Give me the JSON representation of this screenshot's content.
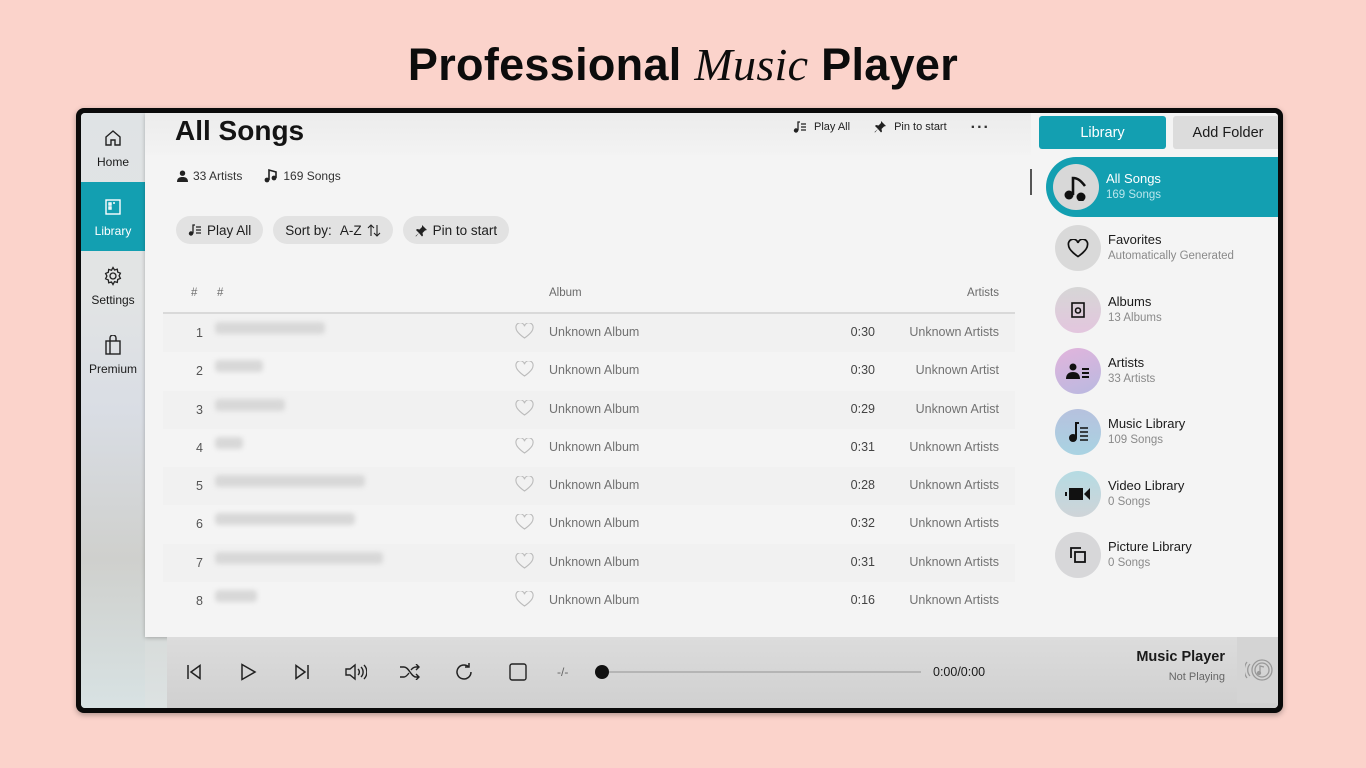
{
  "headline": {
    "part1": "Professional",
    "part2": "Music",
    "part3": "Player"
  },
  "nav": {
    "items": [
      {
        "label": "Home",
        "icon": "home-icon",
        "active": false
      },
      {
        "label": "Library",
        "icon": "library-icon",
        "active": true
      },
      {
        "label": "Settings",
        "icon": "gear-icon",
        "active": false
      },
      {
        "label": "Premium",
        "icon": "shopping-bag-icon",
        "active": false
      }
    ]
  },
  "main": {
    "title": "All Songs",
    "top_actions": {
      "play_all": "Play All",
      "pin_to_start": "Pin to start",
      "more": "..."
    },
    "stats": {
      "artists": "33 Artists",
      "songs": "169 Songs"
    },
    "pills": {
      "play_all": "Play All",
      "sort_label": "Sort by:",
      "sort_value": "A-Z",
      "pin_to_start": "Pin to start"
    },
    "table": {
      "headers": {
        "num": "#",
        "title": "#",
        "album": "Album",
        "artists": "Artists"
      },
      "rows": [
        {
          "num": "1",
          "title": "[blurred]",
          "album": "Unknown Album",
          "duration": "0:30",
          "artist": "Unknown Artists"
        },
        {
          "num": "2",
          "title": "[blurred]",
          "album": "Unknown Album",
          "duration": "0:30",
          "artist": "Unknown Artist"
        },
        {
          "num": "3",
          "title": "[blurred]",
          "album": "Unknown Album",
          "duration": "0:29",
          "artist": "Unknown Artist"
        },
        {
          "num": "4",
          "title": "[blurred]",
          "album": "Unknown Album",
          "duration": "0:31",
          "artist": "Unknown Artists"
        },
        {
          "num": "5",
          "title": "[blurred]",
          "album": "Unknown Album",
          "duration": "0:28",
          "artist": "Unknown Artists"
        },
        {
          "num": "6",
          "title": "[blurred]",
          "album": "Unknown Album",
          "duration": "0:32",
          "artist": "Unknown Artists"
        },
        {
          "num": "7",
          "title": "[blurred]",
          "album": "Unknown Album",
          "duration": "0:31",
          "artist": "Unknown Artists"
        },
        {
          "num": "8",
          "title": "[blurred]",
          "album": "Unknown Album",
          "duration": "0:16",
          "artist": "Unknown Artists"
        }
      ]
    }
  },
  "right_panel": {
    "tabs": {
      "library": "Library",
      "add_folder": "Add Folder"
    },
    "categories": [
      {
        "label": "All Songs",
        "sub": "169 Songs",
        "icon": "music-notes-icon",
        "active": true
      },
      {
        "label": "Favorites",
        "sub": "Automatically Generated",
        "icon": "heart-icon",
        "active": false
      },
      {
        "label": "Albums",
        "sub": "13 Albums",
        "icon": "album-icon",
        "active": false
      },
      {
        "label": "Artists",
        "sub": "33 Artists",
        "icon": "artist-list-icon",
        "active": false
      },
      {
        "label": "Music Library",
        "sub": "109 Songs",
        "icon": "music-list-icon",
        "active": false
      },
      {
        "label": "Video Library",
        "sub": "0 Songs",
        "icon": "video-camera-icon",
        "active": false
      },
      {
        "label": "Picture Library",
        "sub": "0 Songs",
        "icon": "pictures-icon",
        "active": false
      }
    ]
  },
  "player": {
    "rate": "-/-",
    "progress": 0,
    "time": "0:00/0:00",
    "now_playing_title": "Music Player",
    "now_playing_status": "Not Playing"
  },
  "colors": {
    "accent": "#139fb1",
    "background": "#fbd3cb"
  }
}
